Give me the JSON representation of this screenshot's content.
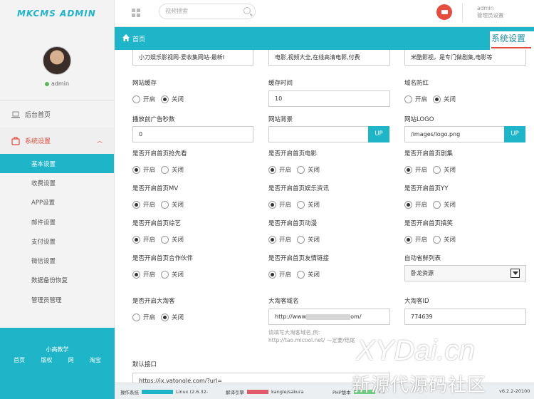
{
  "brand": "MKCMS ADMIN",
  "search_placeholder": "视频搜索",
  "user": {
    "name": "admin",
    "role": "管理员设置"
  },
  "profile": {
    "name": "admin"
  },
  "sidebar": {
    "items": [
      {
        "label": "后台首页"
      },
      {
        "label": "系统设置"
      }
    ],
    "sub_items": [
      "基本设置",
      "收费设置",
      "APP设置",
      "邮件设置",
      "支付设置",
      "微信设置",
      "数据备份恢复",
      "管理员管理"
    ],
    "footer_title": "小高教学",
    "footer_links": [
      "首页",
      "版权",
      "网",
      "淘宝"
    ]
  },
  "header": {
    "home": "首页",
    "tab": "系统设置"
  },
  "form": {
    "top_values": [
      "小刀娱乐影视网-爱收集网站-最新I",
      "电影,视频大全,在线高清电影,付费",
      "米酷影视，是专门做剧集,电影等"
    ],
    "site_cache": {
      "label": "网站缓存",
      "on": "开启",
      "off": "关闭"
    },
    "cache_time": {
      "label": "缓存时间",
      "value": "10"
    },
    "domain_guard": {
      "label": "域名防红",
      "on": "开启",
      "off": "关闭"
    },
    "ad_seconds": {
      "label": "播放前广告秒数",
      "value": "0"
    },
    "site_bg": {
      "label": "网站背景",
      "value": "",
      "button": "UP"
    },
    "site_logo": {
      "label": "网站LOGO",
      "value": "/images/logo.png",
      "button": "UP"
    },
    "row4": [
      "是否开启首页抢先看",
      "是否开启首页电影",
      "是否开启首页剧集"
    ],
    "row5": [
      "是否开启首页MV",
      "是否开启首页娱乐资讯",
      "是否开启首页YY"
    ],
    "row6": [
      "是否开启首页综艺",
      "是否开启首页动漫",
      "是否开启首页搞笑"
    ],
    "row7": [
      "是否开启首页合作伙伴",
      "是否开启首页友情链接"
    ],
    "auto_list": {
      "label": "自动省鲜列表",
      "value": "卧龙资源"
    },
    "taoke": {
      "label": "是否开启大淘客",
      "on": "开启",
      "off": "关闭"
    },
    "taoke_domain": {
      "label": "大淘客域名",
      "value_prefix": "http://www",
      "value_suffix": "om/",
      "hint1": "请填写大淘客域名,例:",
      "hint2": "http://tao.micool.net/ 一定要/结尾"
    },
    "taoke_id": {
      "label": "大淘客ID",
      "value": "774639"
    },
    "default_api": {
      "label": "默认接口",
      "value": "https://jx.vatongle.com/?url="
    },
    "on_label": "开启",
    "off_label": "关闭"
  },
  "status": {
    "os_label": "操作系统",
    "os_value": "Linux (2.6.32-",
    "server_label": "解译引擎",
    "server_value": "kangle/sakura",
    "php_label": "PHP版本",
    "php_value": "v6.2.2-20100",
    "extra": "7.2"
  },
  "watermark": {
    "line1": "XYDai.cn",
    "line2": "新源代源码社区"
  },
  "colors": {
    "accent": "#1fb5c9",
    "danger": "#e04b3d"
  }
}
